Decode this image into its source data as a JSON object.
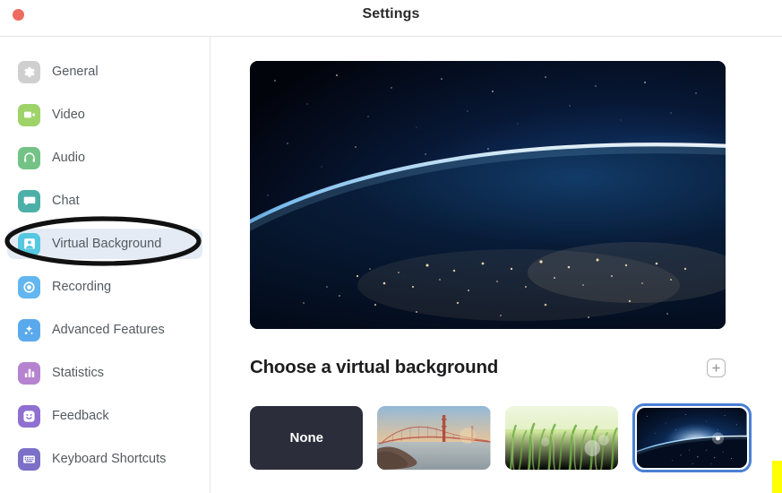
{
  "window": {
    "title": "Settings",
    "close_button": "close-button"
  },
  "sidebar": {
    "items": [
      {
        "label": "General",
        "icon": "gear-icon",
        "color": "#cfcfcf",
        "active": false
      },
      {
        "label": "Video",
        "icon": "video-camera-icon",
        "color": "#9ed36a",
        "active": false
      },
      {
        "label": "Audio",
        "icon": "headphones-icon",
        "color": "#73c386",
        "active": false
      },
      {
        "label": "Chat",
        "icon": "speech-bubble-icon",
        "color": "#4cb0a8",
        "active": false
      },
      {
        "label": "Virtual Background",
        "icon": "person-portrait-icon",
        "color": "#56c7e0",
        "active": true
      },
      {
        "label": "Recording",
        "icon": "record-circle-icon",
        "color": "#63b6ef",
        "active": false
      },
      {
        "label": "Advanced Features",
        "icon": "sparkles-icon",
        "color": "#5aa9ec",
        "active": false
      },
      {
        "label": "Statistics",
        "icon": "bar-chart-icon",
        "color": "#b583cf",
        "active": false
      },
      {
        "label": "Feedback",
        "icon": "smiley-face-icon",
        "color": "#8f6fd0",
        "active": false
      },
      {
        "label": "Keyboard Shortcuts",
        "icon": "keyboard-icon",
        "color": "#7b6fc8",
        "active": false
      }
    ]
  },
  "annotation": {
    "ellipse_target": "Virtual Background",
    "ellipse_color": "#111111",
    "marker_color": "#ffff00"
  },
  "main": {
    "preview_alt": "Earth from space at night with city lights and sunrise glow",
    "section_title": "Choose a virtual background",
    "add_button": "add-background-icon",
    "thumbnails": [
      {
        "label": "None",
        "kind": "none",
        "selected": false
      },
      {
        "label": "Golden Gate Bridge",
        "kind": "bridge",
        "selected": false
      },
      {
        "label": "Grass",
        "kind": "grass",
        "selected": false
      },
      {
        "label": "Earth",
        "kind": "earth",
        "selected": true
      }
    ]
  },
  "colors": {
    "accent": "#4a7fd4",
    "active_nav_bg": "#e4ebf5",
    "close": "#ec6a5e"
  }
}
